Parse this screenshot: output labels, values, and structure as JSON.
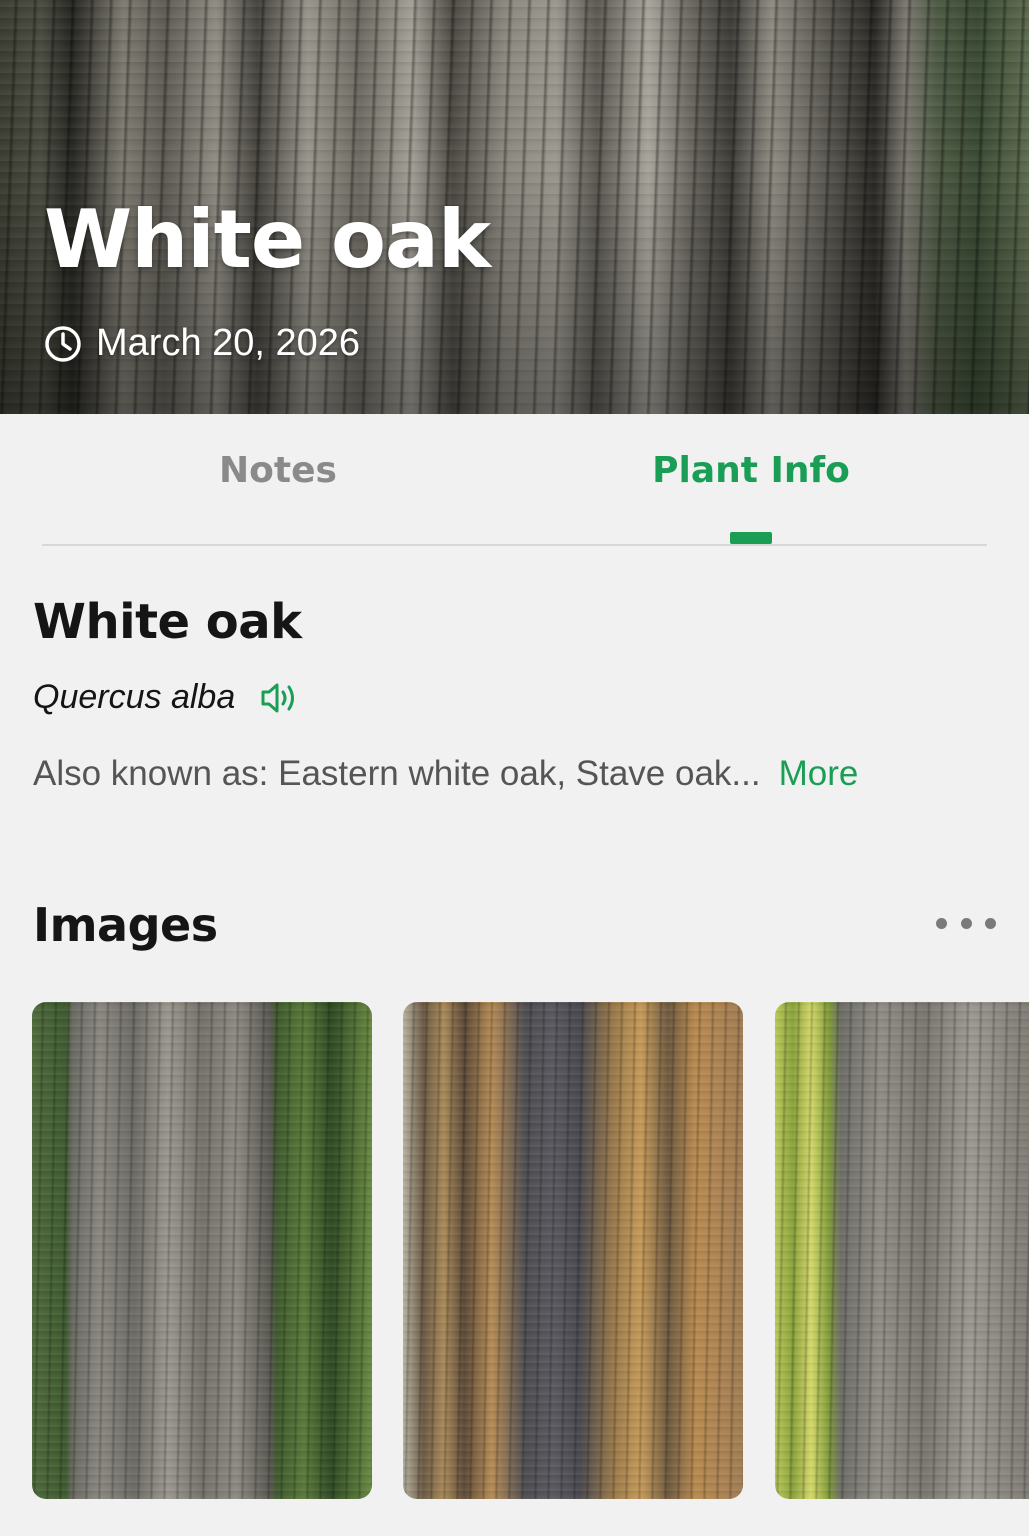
{
  "hero": {
    "title": "White oak",
    "date": "March 20, 2026",
    "date_icon": "clock-icon"
  },
  "tabs": [
    {
      "label": "Notes",
      "active": false
    },
    {
      "label": "Plant Info",
      "active": true
    }
  ],
  "plant": {
    "common_name": "White oak",
    "scientific_name": "Quercus alba",
    "pronounce_icon": "speaker-icon",
    "also_known_as": "Also known as: Eastern white oak, Stave oak...",
    "more_label": "More"
  },
  "images_section": {
    "title": "Images",
    "more_icon": "ellipsis-icon",
    "thumbnails": [
      "oak-bark-photo",
      "forest-trunk-photo",
      "oak-trunk-closeup-photo"
    ]
  },
  "colors": {
    "accent": "#1a9e55",
    "inactive_tab": "#8a8a8a",
    "text_primary": "#151515",
    "text_secondary": "#555555",
    "background": "#f2f1f2"
  }
}
